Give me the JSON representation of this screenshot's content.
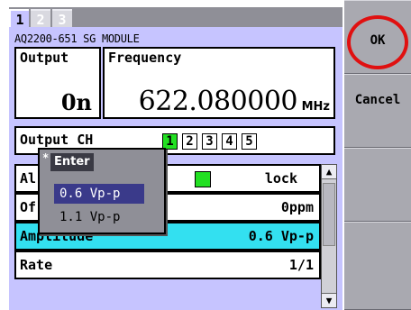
{
  "tabs": [
    "1",
    "2",
    "3"
  ],
  "module_title": "AQ2200-651 SG MODULE",
  "output": {
    "label": "Output",
    "value": "0n"
  },
  "frequency": {
    "label": "Frequency",
    "value": "622.080000",
    "unit": "MHz"
  },
  "output_ch": {
    "label": "Output CH",
    "channels": [
      "1",
      "2",
      "3",
      "4",
      "5"
    ],
    "selected": "1"
  },
  "rows": [
    {
      "label": "Al",
      "value": "lock"
    },
    {
      "label": "Of",
      "value": "0ppm"
    },
    {
      "label": "Amplitude",
      "value": "0.6 Vp-p"
    },
    {
      "label": "Rate",
      "value": "1/1"
    }
  ],
  "popup": {
    "mark": "*",
    "title": "Enter",
    "options": [
      "0.6 Vp-p",
      "1.1 Vp-p"
    ],
    "selected": "0.6 Vp-p"
  },
  "softkeys": {
    "ok": "OK",
    "cancel": "Cancel"
  },
  "colors": {
    "panel": "#c6c4ff",
    "highlight": "#33e0f0",
    "channel_selected": "#22e022",
    "ok_ring": "#e01010"
  }
}
